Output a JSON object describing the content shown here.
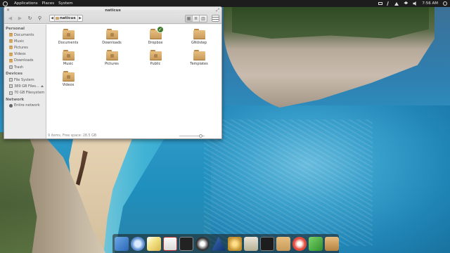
{
  "panel": {
    "menus": [
      "Applications",
      "Places",
      "System"
    ],
    "time": "7:56 AM"
  },
  "window": {
    "title": "naticus",
    "path_segment": "naticus",
    "status": "9 items, Free space: 28.5 GB"
  },
  "sidebar": {
    "sections": [
      {
        "heading": "Personal",
        "items": [
          {
            "label": "Documents",
            "icon": "folder-icon"
          },
          {
            "label": "Music",
            "icon": "folder-icon"
          },
          {
            "label": "Pictures",
            "icon": "folder-icon"
          },
          {
            "label": "Videos",
            "icon": "folder-icon"
          },
          {
            "label": "Downloads",
            "icon": "folder-icon"
          },
          {
            "label": "Trash",
            "icon": "trash-icon"
          }
        ]
      },
      {
        "heading": "Devices",
        "items": [
          {
            "label": "File System",
            "icon": "drive-icon"
          },
          {
            "label": "389 GB Files...",
            "icon": "drive-icon",
            "eject": true
          },
          {
            "label": "70 GB Filesystem",
            "icon": "drive-icon"
          }
        ]
      },
      {
        "heading": "Network",
        "items": [
          {
            "label": "Entire network",
            "icon": "network-icon"
          }
        ]
      }
    ]
  },
  "files": [
    {
      "label": "Documents",
      "badge": false
    },
    {
      "label": "Downloads",
      "badge": false
    },
    {
      "label": "Dropbox",
      "badge": true
    },
    {
      "label": "GNUstep",
      "badge": false
    },
    {
      "label": "Music",
      "badge": false
    },
    {
      "label": "Pictures",
      "badge": false
    },
    {
      "label": "Public",
      "badge": false
    },
    {
      "label": "Templates",
      "badge": false
    },
    {
      "label": "Videos",
      "badge": false
    }
  ],
  "dock": {
    "items": [
      "mail-app-icon",
      "web-browser-icon",
      "notes-icon",
      "calendar-icon",
      "terminal-icon",
      "music-player-icon",
      "app-launcher-icon",
      "settings-icon",
      "calculator-icon",
      "system-monitor-icon",
      "files-icon",
      "media-player-icon",
      "android-icon",
      "archive-icon"
    ]
  }
}
